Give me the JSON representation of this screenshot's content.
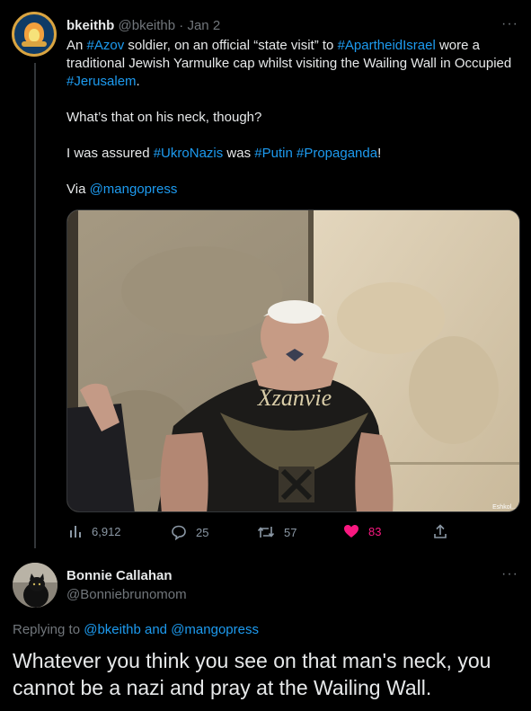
{
  "tweet": {
    "display_name": "bkeithb",
    "handle": "@bkeithb",
    "dot": "·",
    "date": "Jan 2",
    "more": "···",
    "line1": {
      "t1": "An ",
      "h_azov": "#Azov",
      "t2": " soldier, on an official “state visit” to ",
      "h_apartheid": "#ApartheidIsrael",
      "t3": " wore a traditional Jewish Yarmulke cap whilst visiting the Wailing Wall in Occupied ",
      "h_jerusalem": "#Jerusalem",
      "t4": "."
    },
    "line2": "What’s that on his neck, though?",
    "line3": {
      "t1": "I was assured ",
      "h_ukro": "#UkroNazis",
      "t2": " was ",
      "h_putin": "#Putin",
      "t3": " ",
      "h_propaganda": "#Propaganda",
      "t4": "!"
    },
    "line4": {
      "t1": "Via ",
      "mention": "@mangopress"
    },
    "photo_watermark": "Eshkol...",
    "shirt_text": "Xzanvie",
    "actions": {
      "views": "6,912",
      "replies": "25",
      "retweets": "57",
      "likes": "83"
    },
    "colors": {
      "link": "#1d9bf0",
      "like": "#f91880",
      "muted": "#71767b"
    }
  },
  "reply_tweet": {
    "display_name": "Bonnie Callahan",
    "handle": "@Bonniebrunomom",
    "more": "···",
    "replying_prefix": "Replying to ",
    "replying_user1": "@bkeithb",
    "replying_and": " and ",
    "replying_user2": "@mangopress",
    "text": "Whatever you think you see on that man's neck, you cannot be a nazi and pray at the Wailing Wall."
  }
}
